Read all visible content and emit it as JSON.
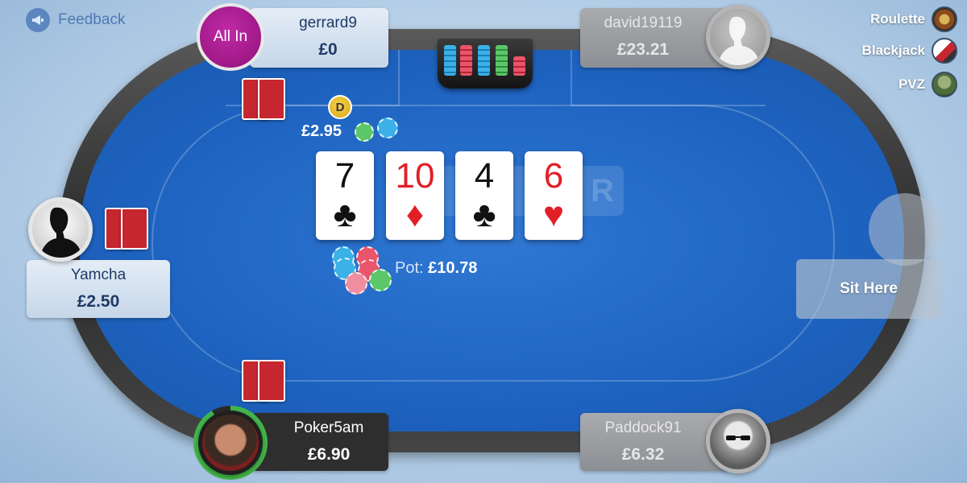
{
  "header": {
    "feedback_label": "Feedback",
    "feedback_icon": "megaphone-icon"
  },
  "side_menu": {
    "items": [
      {
        "label": "Roulette",
        "icon": "roulette-wheel-icon"
      },
      {
        "label": "Blackjack",
        "icon": "blackjack-cards-icon"
      },
      {
        "label": "PVZ",
        "icon": "zombie-icon"
      }
    ]
  },
  "table": {
    "watermark": "R",
    "dealer_button": "D",
    "bet": {
      "amount": "£2.95"
    },
    "pot": {
      "label": "Pot:",
      "amount": "£10.78"
    },
    "community_cards": [
      {
        "rank": "7",
        "suit": "♣",
        "color": "black"
      },
      {
        "rank": "10",
        "suit": "♦",
        "color": "red"
      },
      {
        "rank": "4",
        "suit": "♣",
        "color": "black"
      },
      {
        "rank": "6",
        "suit": "♥",
        "color": "red"
      }
    ]
  },
  "players": {
    "gerrard9": {
      "name": "gerrard9",
      "stack": "£0",
      "status": "All In"
    },
    "david19119": {
      "name": "david19119",
      "stack": "£23.21"
    },
    "yamcha": {
      "name": "Yamcha",
      "stack": "£2.50"
    },
    "poker5am": {
      "name": "Poker5am",
      "stack": "£6.90"
    },
    "paddock91": {
      "name": "Paddock91",
      "stack": "£6.32"
    }
  },
  "empty_seat": {
    "label": "Sit Here"
  },
  "colors": {
    "felt": "#1e63c0",
    "all_in": "#b0209a",
    "card_back": "#c6262f",
    "timer_ring": "#43b649"
  }
}
